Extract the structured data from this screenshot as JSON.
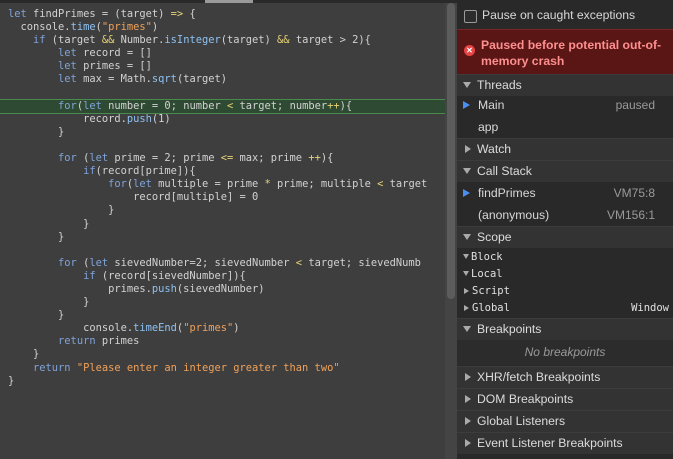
{
  "editor": {
    "code": [
      "let findPrimes = (target) => {",
      "  console.time(\"primes\")",
      "    if (target && Number.isInteger(target) && target > 2){",
      "        let record = []",
      "        let primes = []",
      "        let max = Math.sqrt(target)",
      "",
      "        for(let number = 0; number < target; number++){",
      "            record.push(1)",
      "        }",
      "",
      "        for (let prime = 2; prime <= max; prime ++){",
      "            if(record[prime]){",
      "                for(let multiple = prime * prime; multiple < target",
      "                    record[multiple] = 0",
      "                }",
      "            }",
      "        }",
      "",
      "        for (let sievedNumber=2; sievedNumber < target; sievedNumb",
      "            if (record[sievedNumber]){",
      "                primes.push(sievedNumber)",
      "            }",
      "        }",
      "            console.timeEnd(\"primes\")",
      "        return primes",
      "    }",
      "    return \"Please enter an integer greater than two\"",
      "}"
    ]
  },
  "panel": {
    "pause_on_caught": "Pause on caught exceptions",
    "error_message": "Paused before potential out-of-memory crash",
    "threads": {
      "title": "Threads",
      "items": [
        {
          "name": "Main",
          "status": "paused"
        },
        {
          "name": "app",
          "status": ""
        }
      ]
    },
    "watch": {
      "title": "Watch"
    },
    "call_stack": {
      "title": "Call Stack",
      "frames": [
        {
          "name": "findPrimes",
          "location": "VM75:8"
        },
        {
          "name": "(anonymous)",
          "location": "VM156:1"
        }
      ]
    },
    "scope": {
      "title": "Scope",
      "items": [
        {
          "name": "Block",
          "value": ""
        },
        {
          "name": "Local",
          "value": ""
        },
        {
          "name": "Script",
          "value": ""
        },
        {
          "name": "Global",
          "value": "Window"
        }
      ]
    },
    "breakpoints": {
      "title": "Breakpoints",
      "empty": "No breakpoints"
    },
    "sections": [
      "XHR/fetch Breakpoints",
      "DOM Breakpoints",
      "Global Listeners",
      "Event Listener Breakpoints"
    ]
  }
}
